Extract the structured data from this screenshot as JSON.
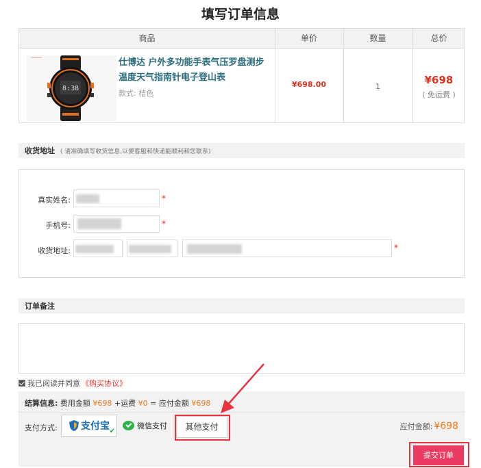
{
  "page_title": "填写订单信息",
  "table": {
    "headers": [
      "商品",
      "单价",
      "数量",
      "总价"
    ],
    "product": {
      "name": "仕博达 户外多功能手表气压罗盘测步温度天气指南针电子登山表",
      "variant": "款式: 桔色",
      "unit_price": "¥698.00",
      "quantity": "1",
      "total": "¥698",
      "total_note": "( 免运费 )"
    }
  },
  "address_section": {
    "title": "收货地址",
    "hint": "( 请准确填写收货信息,以便客服和快递能顺利和您联系)"
  },
  "form": {
    "name_label": "真实姓名:",
    "phone_label": "手机号:",
    "address_label": "收货地址:",
    "required_mark": "*"
  },
  "notes_section": {
    "title": "订单备注"
  },
  "agreement": {
    "text": "我已阅读并同意",
    "link": "《购买协议》",
    "checked": true
  },
  "summary": {
    "label": "结算信息:",
    "fee_label": "费用金额",
    "fee": "¥698",
    "shipping_label": "+运费",
    "shipping": "¥0",
    "eq_label": "= 应付金额",
    "payable": "¥698"
  },
  "payment": {
    "label": "支付方式:",
    "alipay": "支付宝",
    "wechat": "微信支付",
    "other": "其他支付",
    "selected": "alipay",
    "due_label": "应付金额:",
    "due_amount": "¥698"
  },
  "submit_label": "提交订单",
  "colors": {
    "price_red": "#dd3322",
    "accent_orange": "#f07a1a",
    "submit_pink": "#ec3b62",
    "annotation_red": "#e8333c",
    "product_link": "#2a6e7e"
  }
}
